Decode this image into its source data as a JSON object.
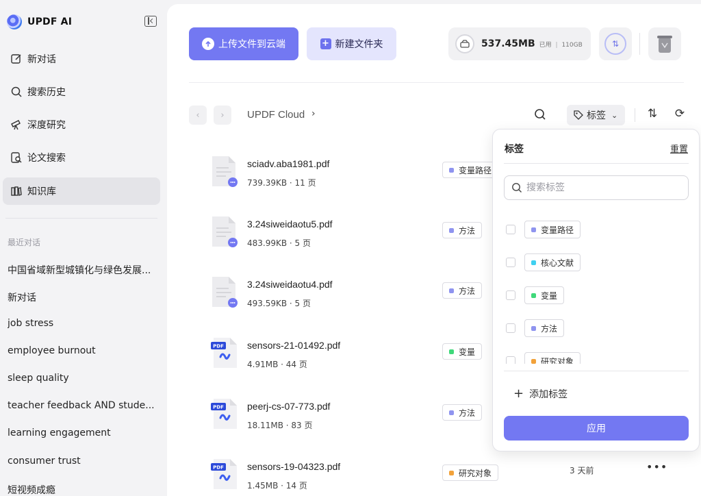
{
  "app": {
    "name": "UPDF AI"
  },
  "sidebar": {
    "items": [
      {
        "label": "新对话",
        "icon": "edit-icon"
      },
      {
        "label": "搜索历史",
        "icon": "search-icon"
      },
      {
        "label": "深度研究",
        "icon": "telescope-icon"
      },
      {
        "label": "论文搜索",
        "icon": "paper-search-icon"
      },
      {
        "label": "知识库",
        "icon": "library-icon",
        "active": true
      }
    ],
    "recent_label": "最近对话",
    "recent": [
      "中国省域新型城镇化与绿色发展...",
      "新对话",
      "job stress",
      "employee burnout",
      "sleep quality",
      "teacher feedback AND stude...",
      "learning engagement",
      "consumer trust",
      "短视频成瘾"
    ]
  },
  "toolbar": {
    "upload_label": "上传文件到云端",
    "new_folder_label": "新建文件夹",
    "storage_used": "537.45MB",
    "storage_used_label": "已用",
    "storage_separator": "|",
    "storage_total": "110GB"
  },
  "breadcrumb": {
    "root": "UPDF Cloud"
  },
  "filter": {
    "tag_label": "标签"
  },
  "files": [
    {
      "name": "sciadv.aba1981.pdf",
      "meta": "739.39KB · 11 页",
      "tag": "变量路径",
      "tag_color": "#8f94ef",
      "type": "doc",
      "date": "",
      "more": ""
    },
    {
      "name": "3.24siweidaotu5.pdf",
      "meta": "483.99KB · 5 页",
      "tag": "方法",
      "tag_color": "#8f94ef",
      "type": "doc",
      "date": "",
      "more": ""
    },
    {
      "name": "3.24siweidaotu4.pdf",
      "meta": "493.59KB · 5 页",
      "tag": "方法",
      "tag_color": "#8f94ef",
      "type": "doc",
      "date": "",
      "more": ""
    },
    {
      "name": "sensors-21-01492.pdf",
      "meta": "4.91MB · 44 页",
      "tag": "变量",
      "tag_color": "#3fd87a",
      "type": "pdf",
      "date": "",
      "more": ""
    },
    {
      "name": "peerj-cs-07-773.pdf",
      "meta": "18.11MB · 83 页",
      "tag": "方法",
      "tag_color": "#8f94ef",
      "type": "pdf",
      "date": "",
      "more": ""
    },
    {
      "name": "sensors-19-04323.pdf",
      "meta": "1.45MB · 14 页",
      "tag": "研究对象",
      "tag_color": "#f2a23a",
      "type": "pdf",
      "date": "3 天前",
      "more": "•••"
    }
  ],
  "pdf_badge": "PDF",
  "tag_panel": {
    "title": "标签",
    "reset_label": "重置",
    "search_placeholder": "搜索标签",
    "tags": [
      {
        "label": "变量路径",
        "color": "#8f94ef"
      },
      {
        "label": "核心文献",
        "color": "#3fd0f0"
      },
      {
        "label": "变量",
        "color": "#3fd87a"
      },
      {
        "label": "方法",
        "color": "#8f94ef"
      },
      {
        "label": "研究对象",
        "color": "#f2a23a"
      }
    ],
    "add_label": "添加标签",
    "apply_label": "应用"
  }
}
